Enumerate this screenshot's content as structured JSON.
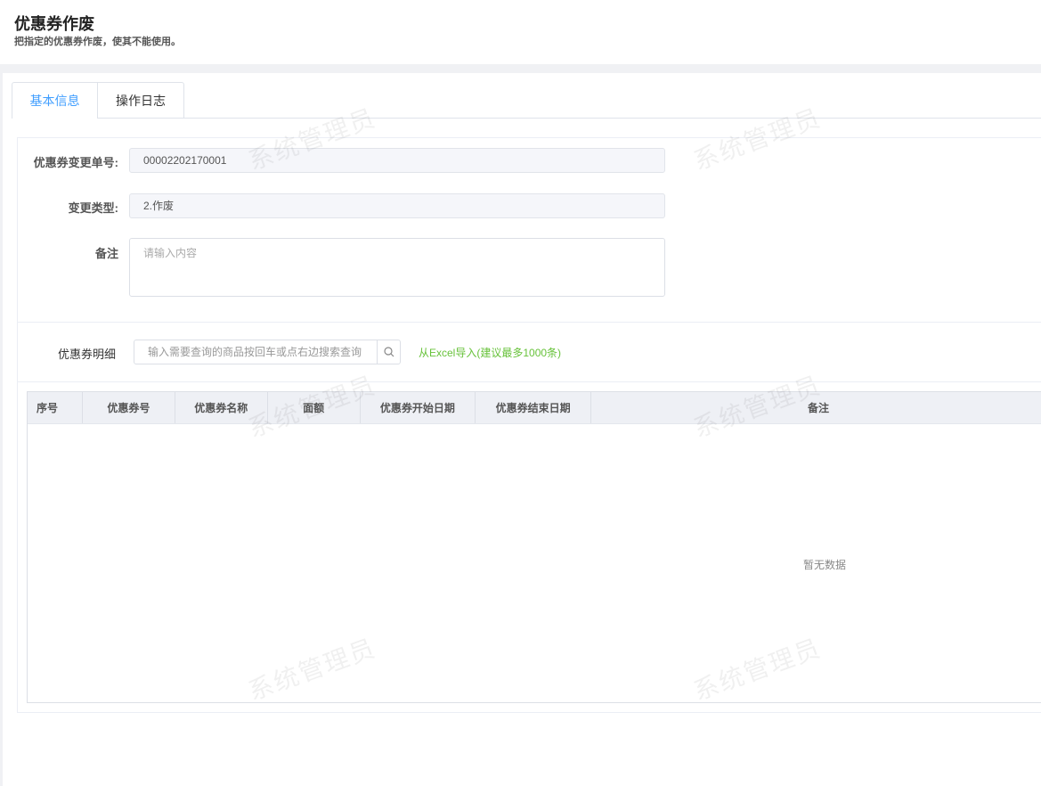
{
  "page": {
    "title": "优惠券作废",
    "subtitle": "把指定的优惠券作废，使其不能使用。"
  },
  "tabs": [
    {
      "label": "基本信息"
    },
    {
      "label": "操作日志"
    }
  ],
  "form": {
    "change_no": {
      "label": "优惠券变更单号:",
      "value": "00002202170001"
    },
    "change_type": {
      "label": "变更类型:",
      "value": "2.作废"
    },
    "remark": {
      "label": "备注",
      "placeholder": "请输入内容"
    }
  },
  "detail": {
    "label": "优惠券明细",
    "search_placeholder": "输入需要查询的商品按回车或点右边搜索查询",
    "import_link": "从Excel导入(建议最多1000条)"
  },
  "table": {
    "columns": [
      "序号",
      "优惠券号",
      "优惠券名称",
      "面额",
      "优惠券开始日期",
      "优惠券结束日期",
      "备注"
    ],
    "empty_text": "暂无数据"
  },
  "watermark": "系统管理员",
  "colors": {
    "accent": "#409eff",
    "link": "#67c23a"
  }
}
